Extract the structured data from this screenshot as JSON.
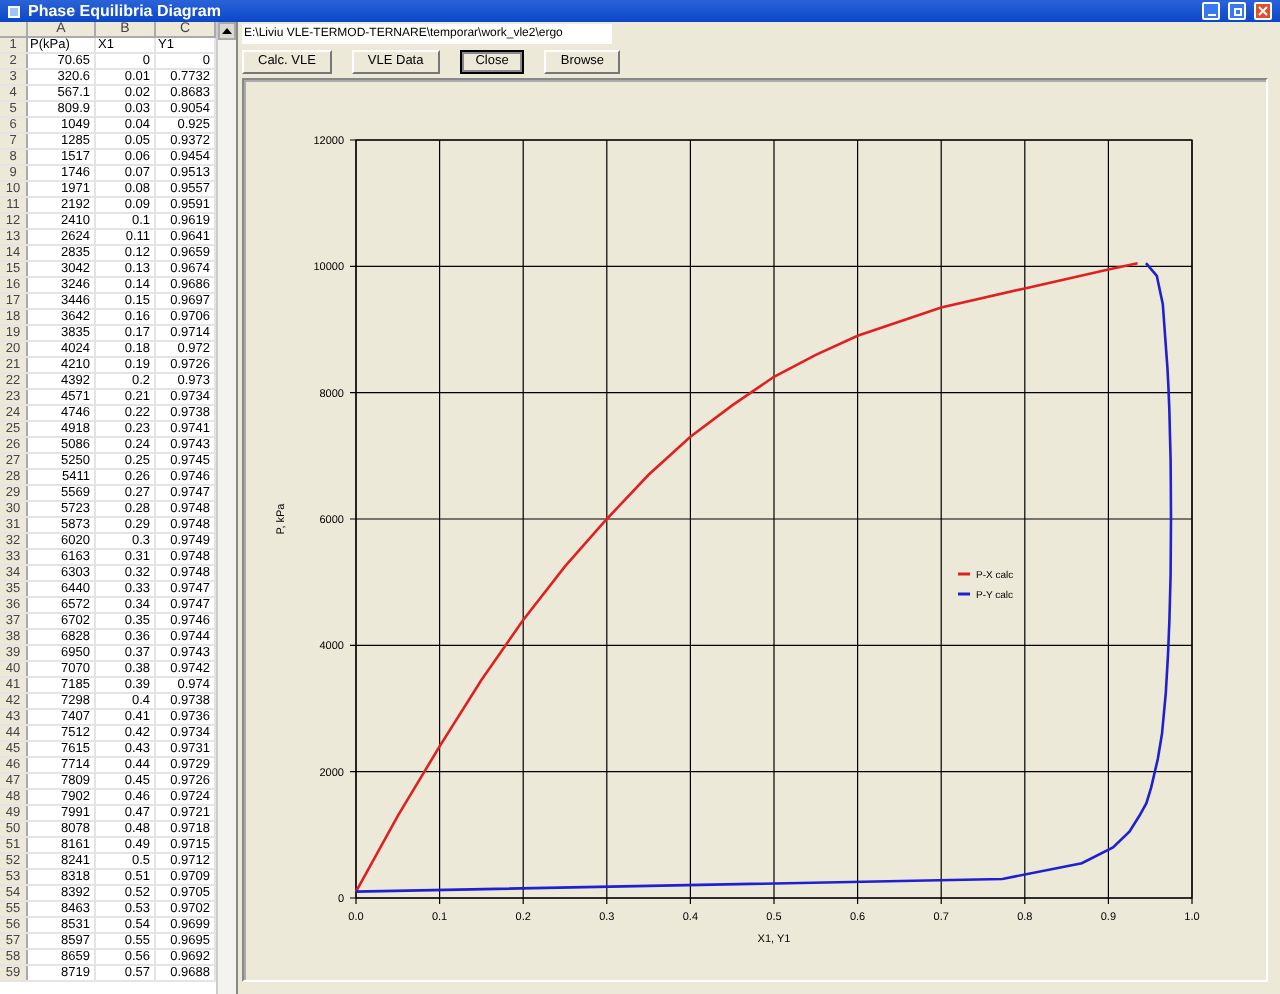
{
  "window": {
    "title": "Phase Equilibria Diagram"
  },
  "sheet": {
    "columns": [
      "A",
      "B",
      "C"
    ],
    "rows": [
      {
        "number": "1",
        "kind": "header",
        "cells": [
          "P(kPa)",
          "X1",
          "Y1"
        ]
      },
      {
        "number": "2",
        "kind": "data",
        "cells": [
          "70.65",
          "0",
          "0"
        ]
      },
      {
        "number": "3",
        "kind": "data",
        "cells": [
          "320.6",
          "0.01",
          "0.7732"
        ]
      },
      {
        "number": "4",
        "kind": "data",
        "cells": [
          "567.1",
          "0.02",
          "0.8683"
        ]
      },
      {
        "number": "5",
        "kind": "data",
        "cells": [
          "809.9",
          "0.03",
          "0.9054"
        ]
      },
      {
        "number": "6",
        "kind": "data",
        "cells": [
          "1049",
          "0.04",
          "0.925"
        ]
      },
      {
        "number": "7",
        "kind": "data",
        "cells": [
          "1285",
          "0.05",
          "0.9372"
        ]
      },
      {
        "number": "8",
        "kind": "data",
        "cells": [
          "1517",
          "0.06",
          "0.9454"
        ]
      },
      {
        "number": "9",
        "kind": "data",
        "cells": [
          "1746",
          "0.07",
          "0.9513"
        ]
      },
      {
        "number": "10",
        "kind": "data",
        "cells": [
          "1971",
          "0.08",
          "0.9557"
        ]
      },
      {
        "number": "11",
        "kind": "data",
        "cells": [
          "2192",
          "0.09",
          "0.9591"
        ]
      },
      {
        "number": "12",
        "kind": "data",
        "cells": [
          "2410",
          "0.1",
          "0.9619"
        ]
      },
      {
        "number": "13",
        "kind": "data",
        "cells": [
          "2624",
          "0.11",
          "0.9641"
        ]
      },
      {
        "number": "14",
        "kind": "data",
        "cells": [
          "2835",
          "0.12",
          "0.9659"
        ]
      },
      {
        "number": "15",
        "kind": "data",
        "cells": [
          "3042",
          "0.13",
          "0.9674"
        ]
      },
      {
        "number": "16",
        "kind": "data",
        "cells": [
          "3246",
          "0.14",
          "0.9686"
        ]
      },
      {
        "number": "17",
        "kind": "data",
        "cells": [
          "3446",
          "0.15",
          "0.9697"
        ]
      },
      {
        "number": "18",
        "kind": "data",
        "cells": [
          "3642",
          "0.16",
          "0.9706"
        ]
      },
      {
        "number": "19",
        "kind": "data",
        "cells": [
          "3835",
          "0.17",
          "0.9714"
        ]
      },
      {
        "number": "20",
        "kind": "data",
        "cells": [
          "4024",
          "0.18",
          "0.972"
        ]
      },
      {
        "number": "21",
        "kind": "data",
        "cells": [
          "4210",
          "0.19",
          "0.9726"
        ]
      },
      {
        "number": "22",
        "kind": "data",
        "cells": [
          "4392",
          "0.2",
          "0.973"
        ]
      },
      {
        "number": "23",
        "kind": "data",
        "cells": [
          "4571",
          "0.21",
          "0.9734"
        ]
      },
      {
        "number": "24",
        "kind": "data",
        "cells": [
          "4746",
          "0.22",
          "0.9738"
        ]
      },
      {
        "number": "25",
        "kind": "data",
        "cells": [
          "4918",
          "0.23",
          "0.9741"
        ]
      },
      {
        "number": "26",
        "kind": "data",
        "cells": [
          "5086",
          "0.24",
          "0.9743"
        ]
      },
      {
        "number": "27",
        "kind": "data",
        "cells": [
          "5250",
          "0.25",
          "0.9745"
        ]
      },
      {
        "number": "28",
        "kind": "data",
        "cells": [
          "5411",
          "0.26",
          "0.9746"
        ]
      },
      {
        "number": "29",
        "kind": "data",
        "cells": [
          "5569",
          "0.27",
          "0.9747"
        ]
      },
      {
        "number": "30",
        "kind": "data",
        "cells": [
          "5723",
          "0.28",
          "0.9748"
        ]
      },
      {
        "number": "31",
        "kind": "data",
        "cells": [
          "5873",
          "0.29",
          "0.9748"
        ]
      },
      {
        "number": "32",
        "kind": "data",
        "cells": [
          "6020",
          "0.3",
          "0.9749"
        ]
      },
      {
        "number": "33",
        "kind": "data",
        "cells": [
          "6163",
          "0.31",
          "0.9748"
        ]
      },
      {
        "number": "34",
        "kind": "data",
        "cells": [
          "6303",
          "0.32",
          "0.9748"
        ]
      },
      {
        "number": "35",
        "kind": "data",
        "cells": [
          "6440",
          "0.33",
          "0.9747"
        ]
      },
      {
        "number": "36",
        "kind": "data",
        "cells": [
          "6572",
          "0.34",
          "0.9747"
        ]
      },
      {
        "number": "37",
        "kind": "data",
        "cells": [
          "6702",
          "0.35",
          "0.9746"
        ]
      },
      {
        "number": "38",
        "kind": "data",
        "cells": [
          "6828",
          "0.36",
          "0.9744"
        ]
      },
      {
        "number": "39",
        "kind": "data",
        "cells": [
          "6950",
          "0.37",
          "0.9743"
        ]
      },
      {
        "number": "40",
        "kind": "data",
        "cells": [
          "7070",
          "0.38",
          "0.9742"
        ]
      },
      {
        "number": "41",
        "kind": "data",
        "cells": [
          "7185",
          "0.39",
          "0.974"
        ]
      },
      {
        "number": "42",
        "kind": "data",
        "cells": [
          "7298",
          "0.4",
          "0.9738"
        ]
      },
      {
        "number": "43",
        "kind": "data",
        "cells": [
          "7407",
          "0.41",
          "0.9736"
        ]
      },
      {
        "number": "44",
        "kind": "data",
        "cells": [
          "7512",
          "0.42",
          "0.9734"
        ]
      },
      {
        "number": "45",
        "kind": "data",
        "cells": [
          "7615",
          "0.43",
          "0.9731"
        ]
      },
      {
        "number": "46",
        "kind": "data",
        "cells": [
          "7714",
          "0.44",
          "0.9729"
        ]
      },
      {
        "number": "47",
        "kind": "data",
        "cells": [
          "7809",
          "0.45",
          "0.9726"
        ]
      },
      {
        "number": "48",
        "kind": "data",
        "cells": [
          "7902",
          "0.46",
          "0.9724"
        ]
      },
      {
        "number": "49",
        "kind": "data",
        "cells": [
          "7991",
          "0.47",
          "0.9721"
        ]
      },
      {
        "number": "50",
        "kind": "data",
        "cells": [
          "8078",
          "0.48",
          "0.9718"
        ]
      },
      {
        "number": "51",
        "kind": "data",
        "cells": [
          "8161",
          "0.49",
          "0.9715"
        ]
      },
      {
        "number": "52",
        "kind": "data",
        "cells": [
          "8241",
          "0.5",
          "0.9712"
        ]
      },
      {
        "number": "53",
        "kind": "data",
        "cells": [
          "8318",
          "0.51",
          "0.9709"
        ]
      },
      {
        "number": "54",
        "kind": "data",
        "cells": [
          "8392",
          "0.52",
          "0.9705"
        ]
      },
      {
        "number": "55",
        "kind": "data",
        "cells": [
          "8463",
          "0.53",
          "0.9702"
        ]
      },
      {
        "number": "56",
        "kind": "data",
        "cells": [
          "8531",
          "0.54",
          "0.9699"
        ]
      },
      {
        "number": "57",
        "kind": "data",
        "cells": [
          "8597",
          "0.55",
          "0.9695"
        ]
      },
      {
        "number": "58",
        "kind": "data",
        "cells": [
          "8659",
          "0.56",
          "0.9692"
        ]
      },
      {
        "number": "59",
        "kind": "data",
        "cells": [
          "8719",
          "0.57",
          "0.9688"
        ]
      }
    ]
  },
  "path_field": {
    "value": "E:\\Liviu VLE-TERMOD-TERNARE\\temporar\\work_vle2\\ergo"
  },
  "buttons": [
    {
      "label": "Calc. VLE",
      "focused": false
    },
    {
      "label": "VLE Data",
      "focused": false
    },
    {
      "label": "Close",
      "focused": true
    },
    {
      "label": "Browse",
      "focused": false
    }
  ],
  "chart": {
    "chart_data": {
      "type": "line",
      "grid": true,
      "legend": true,
      "xlabel": "X1, Y1",
      "ylabel": "P, kPa",
      "xlim": [
        0,
        1
      ],
      "ylim": [
        0,
        12000
      ],
      "xticks": [
        {
          "value": 0,
          "label": "0.0"
        },
        {
          "value": 0.1,
          "label": "0.1"
        },
        {
          "value": 0.2,
          "label": "0.2"
        },
        {
          "value": 0.3,
          "label": "0.3"
        },
        {
          "value": 0.4,
          "label": "0.4"
        },
        {
          "value": 0.5,
          "label": "0.5"
        },
        {
          "value": 0.6,
          "label": "0.6"
        },
        {
          "value": 0.7,
          "label": "0.7"
        },
        {
          "value": 0.8,
          "label": "0.8"
        },
        {
          "value": 0.9,
          "label": "0.9"
        },
        {
          "value": 1,
          "label": "1.0"
        }
      ],
      "yticks": [
        0,
        2000,
        4000,
        6000,
        8000,
        10000,
        12000
      ],
      "series": [
        {
          "name": "P-X calc",
          "color": "#e02020",
          "x": [
            0,
            0.05,
            0.1,
            0.15,
            0.2,
            0.25,
            0.3,
            0.35,
            0.4,
            0.45,
            0.5,
            0.55,
            0.6,
            0.7,
            0.8,
            0.9,
            0.935
          ],
          "values": [
            100,
            1300,
            2400,
            3450,
            4400,
            5250,
            6000,
            6700,
            7300,
            7800,
            8250,
            8600,
            8900,
            9350,
            9650,
            9950,
            10050
          ]
        },
        {
          "name": "P-Y calc",
          "color": "#2020d0",
          "x": [
            0,
            0.7732,
            0.8683,
            0.9054,
            0.925,
            0.9372,
            0.9454,
            0.9513,
            0.9591,
            0.9641,
            0.9686,
            0.9714,
            0.973,
            0.9743,
            0.9747,
            0.9749,
            0.9747,
            0.9743,
            0.9738,
            0.9729,
            0.9718,
            0.9705,
            0.9688,
            0.965,
            0.958,
            0.945
          ],
          "values": [
            100,
            300,
            550,
            800,
            1050,
            1300,
            1500,
            1750,
            2200,
            2600,
            3250,
            3850,
            4400,
            5100,
            5550,
            6000,
            6550,
            6950,
            7300,
            7700,
            8100,
            8400,
            8700,
            9400,
            9850,
            10050
          ]
        }
      ]
    }
  }
}
